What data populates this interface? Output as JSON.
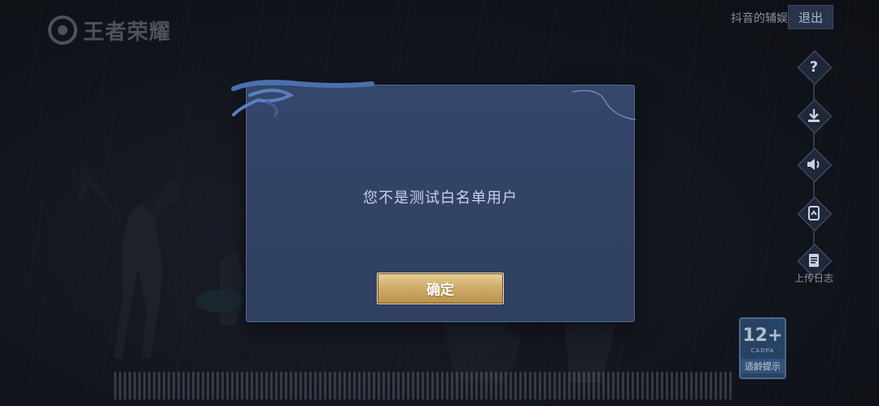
{
  "header": {
    "game_logo_text": "王者荣耀",
    "account_name": "抖音的辅娱",
    "logout_label": "退出"
  },
  "side_tools": {
    "items": [
      {
        "icon": "help-icon"
      },
      {
        "icon": "download-icon"
      },
      {
        "icon": "sound-icon"
      },
      {
        "icon": "repair-icon"
      },
      {
        "icon": "log-icon",
        "label": "上传日志"
      }
    ]
  },
  "age_rating": {
    "age": "12+",
    "org": "CADPA",
    "tip": "适龄提示"
  },
  "modal": {
    "message": "您不是测试白名单用户",
    "confirm_label": "确定"
  }
}
